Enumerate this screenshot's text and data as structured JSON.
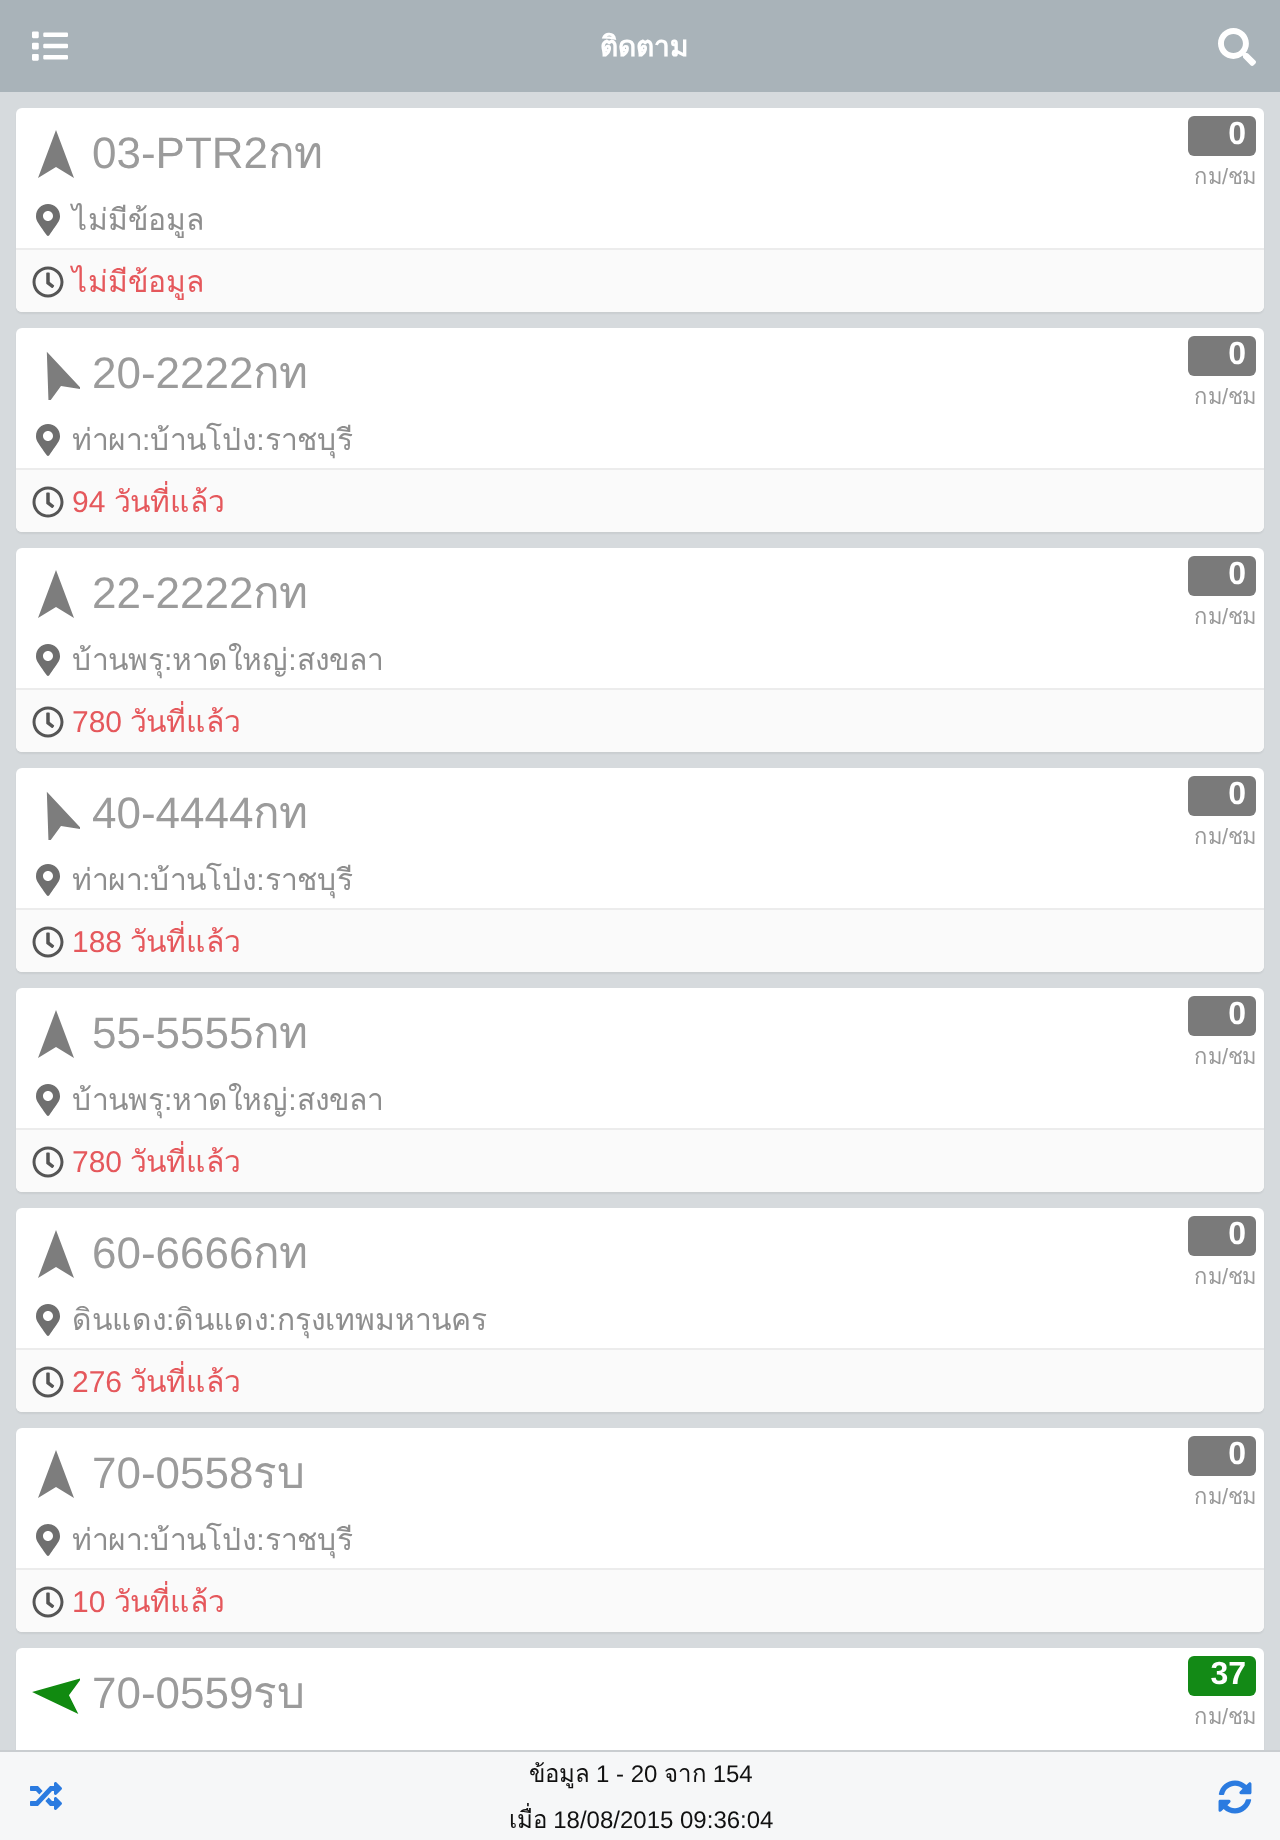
{
  "header": {
    "title": "ติดตาม"
  },
  "vehicles": [
    {
      "plate": "03-PTR2กท",
      "kind": "n",
      "moving": false,
      "speed": "0",
      "speed_unit": "กม/ชม",
      "location": "ไม่มีข้อมูล",
      "last_update": "ไม่มีข้อมูล"
    },
    {
      "plate": "20-2222กท",
      "kind": "nnw",
      "moving": false,
      "speed": "0",
      "speed_unit": "กม/ชม",
      "location": "ท่าผา:บ้านโป่ง:ราชบุรี",
      "last_update": "94 วันที่แล้ว"
    },
    {
      "plate": "22-2222กท",
      "kind": "n",
      "moving": false,
      "speed": "0",
      "speed_unit": "กม/ชม",
      "location": "บ้านพรุ:หาดใหญ่:สงขลา",
      "last_update": "780 วันที่แล้ว"
    },
    {
      "plate": "40-4444กท",
      "kind": "nnw",
      "moving": false,
      "speed": "0",
      "speed_unit": "กม/ชม",
      "location": "ท่าผา:บ้านโป่ง:ราชบุรี",
      "last_update": "188 วันที่แล้ว"
    },
    {
      "plate": "55-5555กท",
      "kind": "n",
      "moving": false,
      "speed": "0",
      "speed_unit": "กม/ชม",
      "location": "บ้านพรุ:หาดใหญ่:สงขลา",
      "last_update": "780 วันที่แล้ว"
    },
    {
      "plate": "60-6666กท",
      "kind": "n",
      "moving": false,
      "speed": "0",
      "speed_unit": "กม/ชม",
      "location": "ดินแดง:ดินแดง:กรุงเทพมหานคร",
      "last_update": "276 วันที่แล้ว"
    },
    {
      "plate": "70-0558รบ",
      "kind": "n",
      "moving": false,
      "speed": "0",
      "speed_unit": "กม/ชม",
      "location": "ท่าผา:บ้านโป่ง:ราชบุรี",
      "last_update": "10 วันที่แล้ว"
    },
    {
      "plate": "70-0559รบ",
      "kind": "w",
      "moving": true,
      "speed": "37",
      "speed_unit": "กม/ชม"
    }
  ],
  "footer": {
    "range": "ข้อมูล 1 - 20 จาก 154",
    "updated": "เมื่อ 18/08/2015 09:36:04"
  }
}
